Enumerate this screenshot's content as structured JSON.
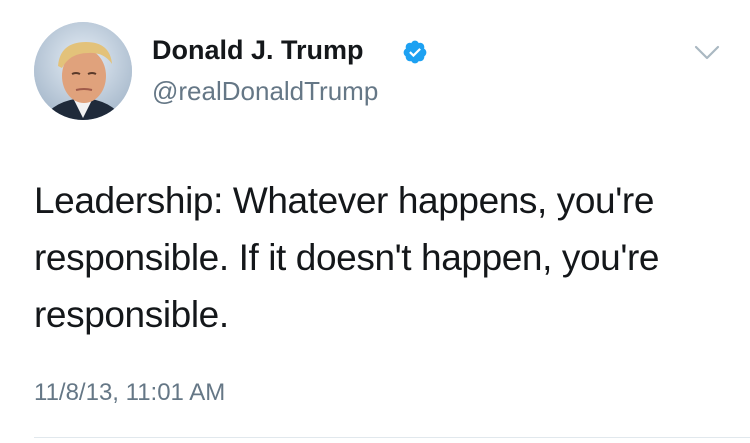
{
  "tweet": {
    "author": {
      "name": "Donald J. Trump",
      "handle": "@realDonaldTrump",
      "verified": true
    },
    "text": "Leadership: Whatever happens, you're responsible. If it doesn't happen, you're responsible.",
    "timestamp": "11/8/13, 11:01 AM"
  },
  "icons": {
    "verified": "verified-badge-icon",
    "menu": "chevron-down-icon",
    "avatar": "profile-photo"
  },
  "colors": {
    "text_primary": "#14171a",
    "text_secondary": "#657786",
    "verified_blue": "#1da1f2",
    "divider": "#e1e8ed"
  }
}
